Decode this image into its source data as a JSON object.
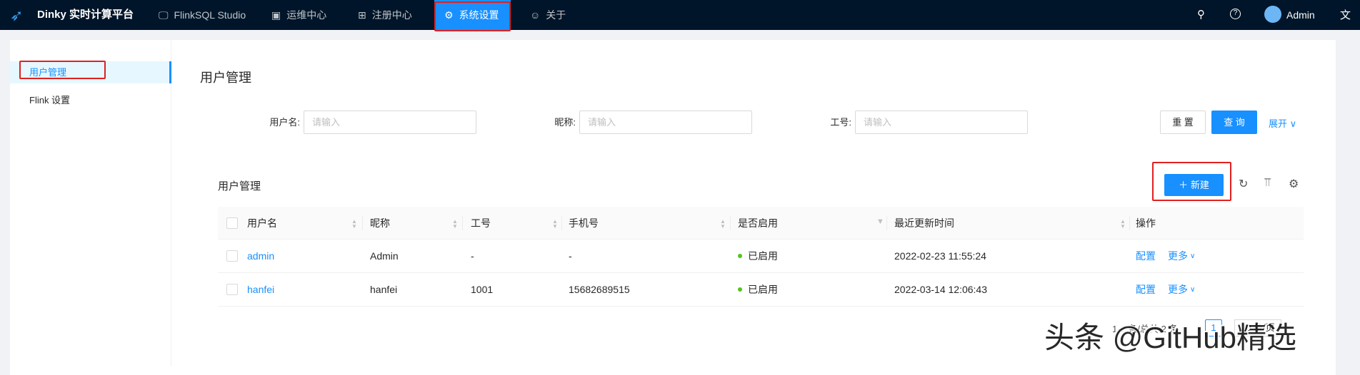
{
  "header": {
    "app_title": "Dinky 实时计算平台",
    "nav": [
      {
        "label": "FlinkSQL Studio",
        "icon": "monitor-icon"
      },
      {
        "label": "运维中心",
        "icon": "dashboard-icon"
      },
      {
        "label": "注册中心",
        "icon": "appstore-icon"
      },
      {
        "label": "系统设置",
        "icon": "gear-icon",
        "active": true
      },
      {
        "label": "关于",
        "icon": "smile-icon"
      }
    ],
    "user": "Admin"
  },
  "sidebar": {
    "items": [
      {
        "label": "用户管理",
        "selected": true
      },
      {
        "label": "Flink 设置"
      }
    ]
  },
  "page": {
    "title": "用户管理"
  },
  "search": {
    "fields": [
      {
        "label": "用户名:",
        "placeholder": "请输入"
      },
      {
        "label": "昵称:",
        "placeholder": "请输入"
      },
      {
        "label": "工号:",
        "placeholder": "请输入"
      }
    ],
    "reset": "重 置",
    "query": "查 询",
    "expand": "展开"
  },
  "table": {
    "title": "用户管理",
    "new_button": "新建",
    "columns": [
      "用户名",
      "昵称",
      "工号",
      "手机号",
      "是否启用",
      "最近更新时间",
      "操作"
    ],
    "rows": [
      {
        "username": "admin",
        "nickname": "Admin",
        "worknum": "-",
        "mobile": "-",
        "status": "已启用",
        "updated": "2022-02-23 11:55:24",
        "action1": "配置",
        "action2": "更多"
      },
      {
        "username": "hanfei",
        "nickname": "hanfei",
        "worknum": "1001",
        "mobile": "15682689515",
        "status": "已启用",
        "updated": "2022-03-14 12:06:43",
        "action1": "配置",
        "action2": "更多"
      }
    ],
    "pagination": {
      "summary": "1-2 条/总共 2 条",
      "current_page": "1",
      "page_size": "20 条/页"
    }
  },
  "watermark": "头条 @GitHub精选",
  "colors": {
    "primary": "#1890ff",
    "header": "#001529",
    "success": "#52c41a",
    "annotation": "#e02020"
  }
}
